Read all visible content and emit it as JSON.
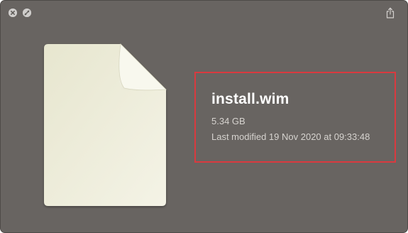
{
  "window": {
    "background": "#686461",
    "controls": [
      {
        "name": "close",
        "icon": "close-icon"
      },
      {
        "name": "fullscreen",
        "icon": "fullscreen-icon"
      }
    ],
    "share_icon": "share-icon"
  },
  "file": {
    "icon": "document-icon",
    "name": "install.wim",
    "size": "5.34 GB",
    "modified": "Last modified 19 Nov 2020 at 09:33:48"
  },
  "highlight": {
    "color": "#d93a3f"
  }
}
